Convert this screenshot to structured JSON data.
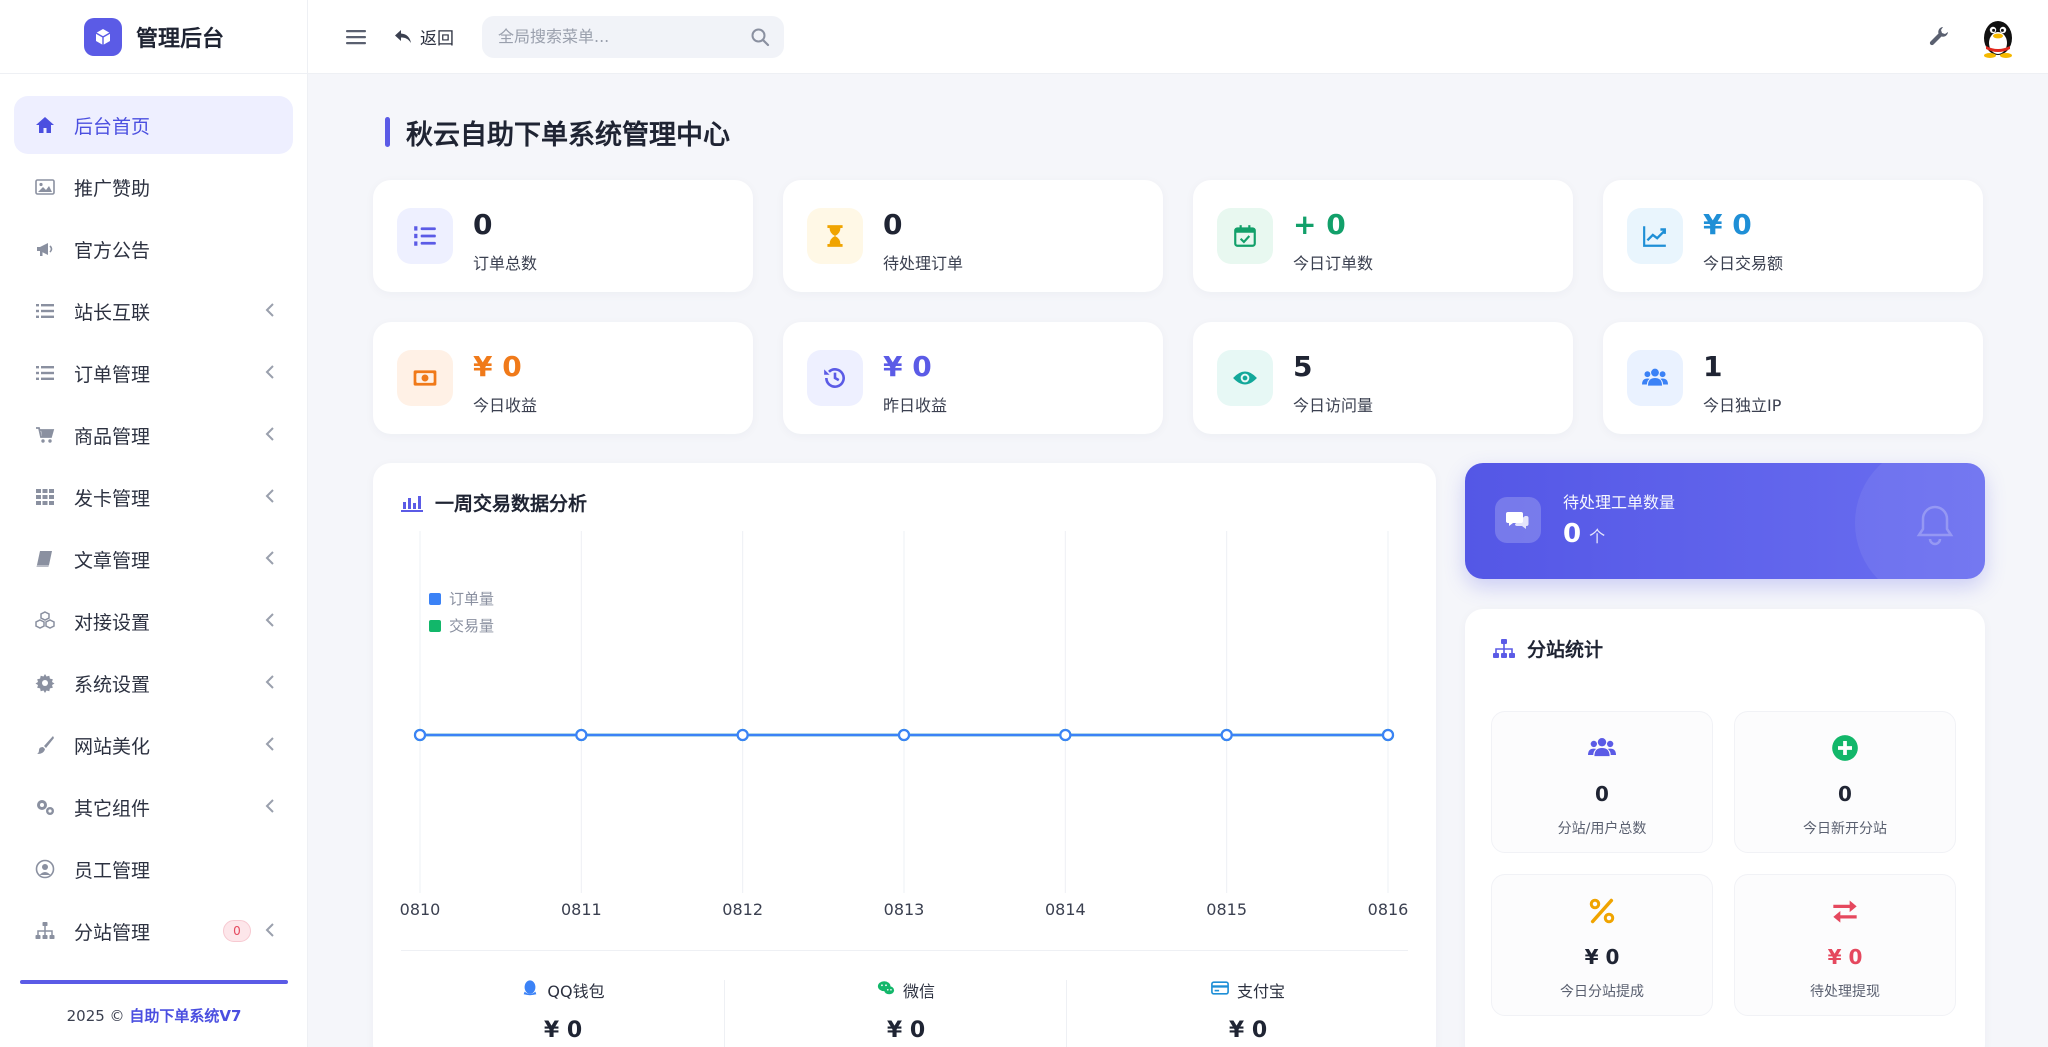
{
  "brand": {
    "title": "管理后台"
  },
  "sidebar": {
    "items": [
      {
        "label": "后台首页",
        "icon": "home-icon",
        "active": true,
        "chevron": false
      },
      {
        "label": "推广赞助",
        "icon": "image-icon",
        "chevron": false
      },
      {
        "label": "官方公告",
        "icon": "megaphone-icon",
        "chevron": false
      },
      {
        "label": "站长互联",
        "icon": "list-icon",
        "chevron": true
      },
      {
        "label": "订单管理",
        "icon": "list-icon",
        "chevron": true
      },
      {
        "label": "商品管理",
        "icon": "cart-icon",
        "chevron": true
      },
      {
        "label": "发卡管理",
        "icon": "grid-icon",
        "chevron": true
      },
      {
        "label": "文章管理",
        "icon": "book-icon",
        "chevron": true
      },
      {
        "label": "对接设置",
        "icon": "cubes-icon",
        "chevron": true
      },
      {
        "label": "系统设置",
        "icon": "gear-icon",
        "chevron": true
      },
      {
        "label": "网站美化",
        "icon": "brush-icon",
        "chevron": true
      },
      {
        "label": "其它组件",
        "icon": "gears-icon",
        "chevron": true
      },
      {
        "label": "员工管理",
        "icon": "user-circle-icon",
        "chevron": false
      },
      {
        "label": "分站管理",
        "icon": "sitemap-icon",
        "chevron": true,
        "badge": "0"
      }
    ],
    "footer_year": "2025 ©",
    "footer_brand": "自助下单系统V7"
  },
  "topbar": {
    "back_label": "返回",
    "search_placeholder": "全局搜索菜单..."
  },
  "page": {
    "title": "秋云自助下单系统管理中心"
  },
  "stats": [
    {
      "value": "0",
      "label": "订单总数",
      "color": "#1f2433",
      "icon": "list-ol-icon",
      "icon_color": "#5b5be6",
      "icon_bg": "#eef0ff"
    },
    {
      "value": "0",
      "label": "待处理订单",
      "color": "#1f2433",
      "icon": "hourglass-icon",
      "icon_color": "#f0a400",
      "icon_bg": "#fff8e6"
    },
    {
      "value": "+ 0",
      "label": "今日订单数",
      "color": "#12a06a",
      "icon": "calendar-check-icon",
      "icon_color": "#12a06a",
      "icon_bg": "#e8f8f0"
    },
    {
      "value": "¥ 0",
      "label": "今日交易额",
      "color": "#1f8fd6",
      "icon": "chart-line-icon",
      "icon_color": "#1f8fd6",
      "icon_bg": "#e9f5fd"
    },
    {
      "value": "¥ 0",
      "label": "今日收益",
      "color": "#f07a1a",
      "icon": "money-bill-icon",
      "icon_color": "#f07a1a",
      "icon_bg": "#fff1e6"
    },
    {
      "value": "¥ 0",
      "label": "昨日收益",
      "color": "#5b5be6",
      "icon": "history-icon",
      "icon_color": "#5b5be6",
      "icon_bg": "#eef0ff"
    },
    {
      "value": "5",
      "label": "今日访问量",
      "color": "#1f2433",
      "icon": "eye-icon",
      "icon_color": "#12a89a",
      "icon_bg": "#e7f8f5"
    },
    {
      "value": "1",
      "label": "今日独立IP",
      "color": "#1f2433",
      "icon": "users-icon",
      "icon_color": "#3b82f6",
      "icon_bg": "#eaf2ff"
    }
  ],
  "weekly": {
    "title": "一周交易数据分析",
    "payments": [
      {
        "name": "QQ钱包",
        "value": "¥ 0",
        "icon": "qq-icon",
        "color": "#3b82f6"
      },
      {
        "name": "微信",
        "value": "¥ 0",
        "icon": "wechat-icon",
        "color": "#12b76a"
      },
      {
        "name": "支付宝",
        "value": "¥ 0",
        "icon": "credit-card-icon",
        "color": "#1f8fd6"
      }
    ]
  },
  "chart_data": {
    "type": "line",
    "categories": [
      "0810",
      "0811",
      "0812",
      "0813",
      "0814",
      "0815",
      "0816"
    ],
    "series": [
      {
        "name": "订单量",
        "values": [
          0,
          0,
          0,
          0,
          0,
          0,
          0
        ],
        "color": "#3b82f6"
      },
      {
        "name": "交易量",
        "values": [
          0,
          0,
          0,
          0,
          0,
          0,
          0
        ],
        "color": "#12b76a"
      }
    ],
    "grid": "vertical",
    "legend": "top-left"
  },
  "ticket": {
    "label": "待处理工单数量",
    "value": "0",
    "unit": "个"
  },
  "substation": {
    "title": "分站统计",
    "items": [
      {
        "value": "0",
        "label": "分站/用户总数",
        "icon": "users-icon",
        "color": "#5b5be6",
        "value_color": "#1f2433"
      },
      {
        "value": "0",
        "label": "今日新开分站",
        "icon": "plus-circle-icon",
        "color": "#12b76a",
        "value_color": "#1f2433"
      },
      {
        "value": "¥ 0",
        "label": "今日分站提成",
        "icon": "percent-icon",
        "color": "#f0a400",
        "value_color": "#1f2433"
      },
      {
        "value": "¥ 0",
        "label": "待处理提现",
        "icon": "exchange-icon",
        "color": "#e5485e",
        "value_color": "#e5485e"
      }
    ]
  }
}
